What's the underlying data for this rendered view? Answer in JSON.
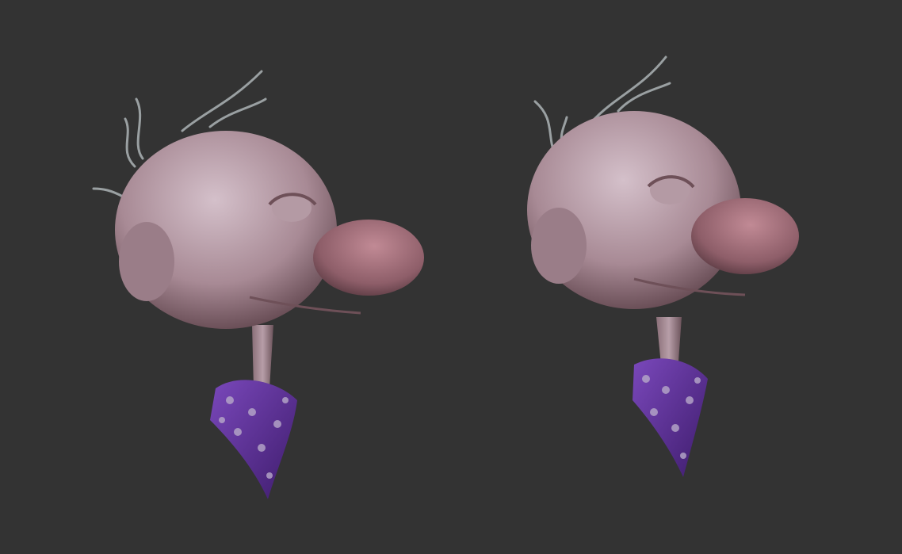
{
  "colors": {
    "background": "#333333",
    "skin_light": "#c9b3bd",
    "skin_mid": "#a88a95",
    "skin_dark": "#6e5058",
    "nose": "#9c6c77",
    "scarf": "#6a3aa8",
    "scarf_dark": "#452076",
    "dots": "#b7a9c9",
    "hair": "#9aa0a2"
  }
}
